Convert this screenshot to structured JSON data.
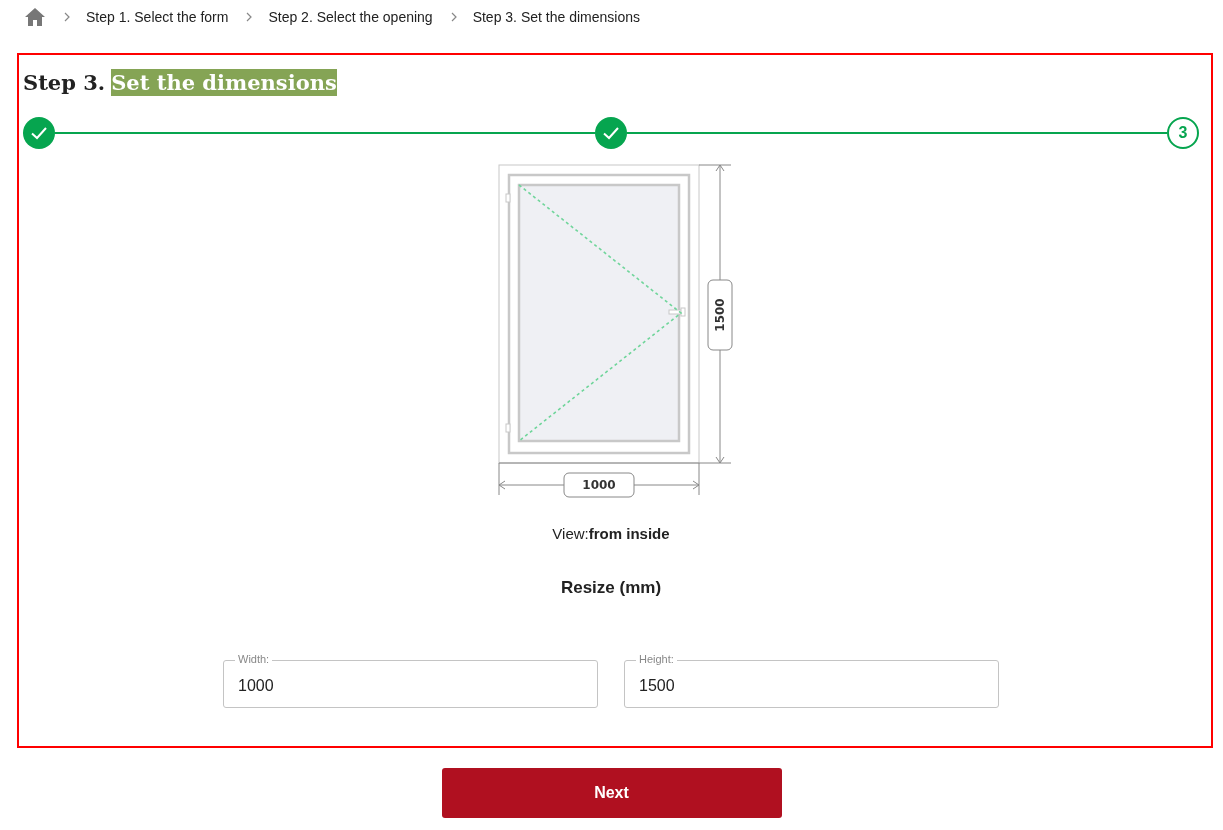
{
  "breadcrumb": [
    {
      "label": "Step 1. Select the form"
    },
    {
      "label": "Step 2. Select the opening"
    },
    {
      "label": "Step 3. Set the dimensions"
    }
  ],
  "heading": {
    "prefix": "Step 3.",
    "highlight": "Set the dimensions"
  },
  "steps": [
    {
      "done": true
    },
    {
      "done": true
    },
    {
      "done": false,
      "number": "3"
    }
  ],
  "drawing": {
    "width_label": "1000",
    "height_label": "1500"
  },
  "view": "View:**from inside**",
  "resize_title": "Resize (mm)",
  "fields": [
    {
      "label": "Width:",
      "value": "1000"
    },
    {
      "label": "Height:",
      "value": "1500"
    }
  ],
  "next_button": "Next"
}
